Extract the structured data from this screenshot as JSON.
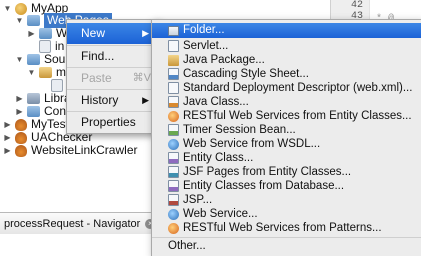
{
  "tree": {
    "rows": [
      {
        "label": "MyApp",
        "icon": "project-icon"
      },
      {
        "label": "Web Pages",
        "icon": "folder-icon"
      },
      {
        "label": "W",
        "icon": "folder-icon"
      },
      {
        "label": "in",
        "icon": "file-icon"
      },
      {
        "label": "Sourc",
        "icon": "folder-icon"
      },
      {
        "label": "m",
        "icon": "package-icon"
      },
      {
        "label": "",
        "icon": "file-icon"
      },
      {
        "label": "Libra",
        "icon": "library-icon"
      },
      {
        "label": "Confi",
        "icon": "folder-icon"
      },
      {
        "label": "MyTestA",
        "icon": "project-icon"
      },
      {
        "label": "UAChecker",
        "icon": "project-icon"
      },
      {
        "label": "WebsiteLinkCrawler",
        "icon": "project-icon"
      }
    ]
  },
  "gutter": {
    "lines": [
      "42",
      "43"
    ]
  },
  "editor": {
    "snippet": "* @"
  },
  "context_menu": {
    "items": [
      {
        "label": "New",
        "arrow": "▶"
      },
      {
        "label": "Find..."
      },
      {
        "label": "Paste",
        "shortcut": "⌘V"
      },
      {
        "label": "History",
        "arrow": "▶"
      },
      {
        "label": "Properties"
      }
    ]
  },
  "submenu": {
    "items": [
      "Folder...",
      "Servlet...",
      "Java Package...",
      "Cascading Style Sheet...",
      "Standard Deployment Descriptor (web.xml)...",
      "Java Class...",
      "RESTful Web Services from Entity Classes...",
      "Timer Session Bean...",
      "Web Service from WSDL...",
      "Entity Class...",
      "JSF Pages from Entity Classes...",
      "Entity Classes from Database...",
      "JSP...",
      "Web Service...",
      "RESTful Web Services from Patterns..."
    ],
    "other": "Other..."
  },
  "navigator": {
    "tab_label": "processRequest - Navigator",
    "close_glyph": "×"
  },
  "colors": {
    "selection": "#1c62d6",
    "menu_bg": "#ececec"
  }
}
